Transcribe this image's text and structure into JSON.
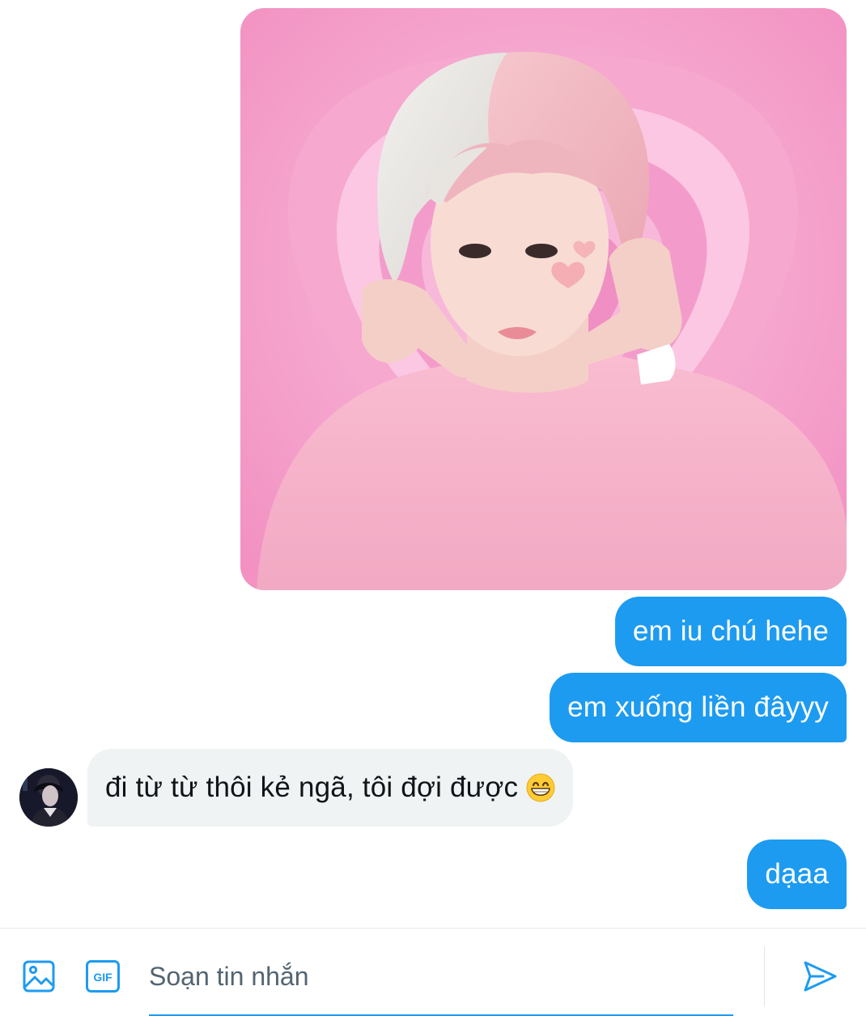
{
  "theme": {
    "accent": "#1d9bf0",
    "outgoing_bubble": "#1d9bf0",
    "incoming_bubble": "#eff3f4",
    "text_primary": "#0f1419",
    "text_secondary": "#536471"
  },
  "conversation": {
    "messages": [
      {
        "type": "image",
        "direction": "outgoing"
      },
      {
        "type": "text",
        "direction": "outgoing",
        "text": "em iu chú hehe"
      },
      {
        "type": "text",
        "direction": "outgoing",
        "text": "em xuống liền đâyyy"
      },
      {
        "type": "text",
        "direction": "incoming",
        "text": "đi từ từ thôi kẻ ngã, tôi đợi được",
        "emoji": "grinning-face-with-smiling-eyes"
      },
      {
        "type": "text",
        "direction": "outgoing",
        "text": "dạaa"
      }
    ]
  },
  "composer": {
    "placeholder": "Soạn tin nhắn",
    "value": "",
    "media_icon": "image-icon",
    "gif_icon": "gif-icon",
    "gif_label": "GIF",
    "send_icon": "send-icon"
  }
}
